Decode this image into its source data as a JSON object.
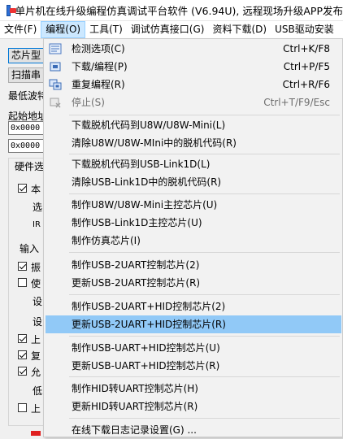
{
  "window": {
    "title": "单片机在线升级编程仿真调试平台软件 (V6.94U), 远程现场升级APP发布"
  },
  "menubar": [
    {
      "label": "文件(F)",
      "active": false
    },
    {
      "label": "编程(O)",
      "active": true
    },
    {
      "label": "工具(T)",
      "active": false
    },
    {
      "label": "调试仿真接口(G)",
      "active": false
    },
    {
      "label": "资料下载(D)",
      "active": false
    },
    {
      "label": "USB驱动安装",
      "active": false
    }
  ],
  "background": {
    "chip_model_button": "芯片型",
    "scan_button": "扫描串",
    "baud_label": "最低波特",
    "start_addr_label": "起始地址",
    "addr_field_1": "0x0000",
    "addr_field_2": "0x0000",
    "hardware_group": "硬件选",
    "opt_1": "本",
    "opt_1_sub_a": "选",
    "opt_1_sub_b": "IR",
    "input_label": "输入",
    "opt_2": "振",
    "opt_3": "使",
    "opt_3_sub_a": "设",
    "opt_3_sub_b": "设",
    "opt_4": "上",
    "opt_5": "复",
    "opt_6": "允",
    "opt_6_sub": "低",
    "opt_7": "上"
  },
  "dropdown": {
    "items": [
      {
        "label": "检测选项(C)",
        "shortcut": "Ctrl+K/F8",
        "icon": "detect-options-icon"
      },
      {
        "label": "下载/编程(P)",
        "shortcut": "Ctrl+P/F5",
        "icon": "download-program-icon"
      },
      {
        "label": "重复编程(R)",
        "shortcut": "Ctrl+R/F6",
        "icon": "repeat-program-icon"
      },
      {
        "label": "停止(S)",
        "shortcut": "Ctrl+T/F9/Esc",
        "icon": "stop-icon",
        "disabled": true
      },
      {
        "label": "下载脱机代码到U8W/U8W-Mini(L)"
      },
      {
        "label": "清除U8W/U8W-MIni中的脱机代码(R)"
      },
      {
        "label": "下载脱机代码到USB-Link1D(L)"
      },
      {
        "label": "清除USB-Link1D中的脱机代码(R)"
      },
      {
        "label": "制作U8W/U8W-Mini主控芯片(U)"
      },
      {
        "label": "制作USB-Link1D主控芯片(U)"
      },
      {
        "label": "制作仿真芯片(I)"
      },
      {
        "label": "制作USB-2UART控制芯片(2)"
      },
      {
        "label": "更新USB-2UART控制芯片(R)"
      },
      {
        "label": "制作USB-2UART+HID控制芯片(2)"
      },
      {
        "label": "更新USB-2UART+HID控制芯片(R)",
        "highlighted": true
      },
      {
        "label": "制作USB-UART+HID控制芯片(U)"
      },
      {
        "label": "更新USB-UART+HID控制芯片(R)"
      },
      {
        "label": "制作HID转UART控制芯片(H)"
      },
      {
        "label": "更新HID转UART控制芯片(R)"
      },
      {
        "label": "在线下载日志记录设置(G) ..."
      }
    ]
  },
  "colors": {
    "highlight": "#91c9f7",
    "active_menu": "#cce8ff",
    "disabled_text": "#6d6d6d"
  }
}
